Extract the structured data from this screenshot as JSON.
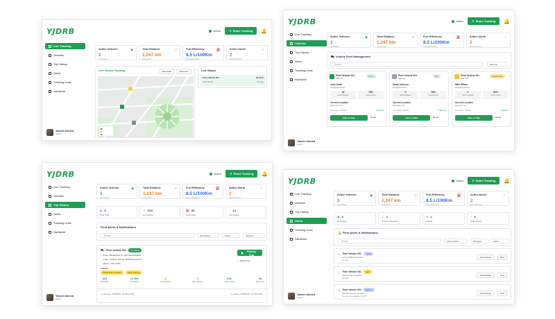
{
  "brand": {
    "logo_text": "YJDRB",
    "accent": "#1f9d55"
  },
  "topbar": {
    "status": "Active",
    "share_button": "Share Tracking"
  },
  "sidebar": {
    "items": [
      {
        "label": "Live Tracking"
      },
      {
        "label": "Vehicles"
      },
      {
        "label": "Trip History"
      },
      {
        "label": "Alerts"
      },
      {
        "label": "Tracking Links"
      },
      {
        "label": "Hardware"
      }
    ]
  },
  "user": {
    "name": "Yasser Ahmed",
    "role": "Admin"
  },
  "kpis": {
    "active_vehicles": {
      "label": "Active Vehicles",
      "value": "1",
      "sub": "All vehicles"
    },
    "total_distance": {
      "label": "Total Distance",
      "value": "1,247 km",
      "sub": "This period"
    },
    "fuel_efficiency": {
      "label": "Fuel Efficiency",
      "value": "8.5 L/100Km",
      "sub": "Avg consumption"
    },
    "active_alerts": {
      "label": "Active Alerts",
      "value": "2",
      "sub": "Need attention"
    }
  },
  "p1": {
    "map_title": "Live Vehicle Tracking",
    "map_btn_1": "MapTrack",
    "map_btn_2": "Fullscreen",
    "live_status_title": "Live Status",
    "status_row_vehicle": "Fleet Vehicle 001",
    "status_row_driver": "John Smith",
    "status_row_speed": "32 km/h",
    "status_row_state": "Moving"
  },
  "p2": {
    "section_title": "Vehicle Fleet Management",
    "search_placeholder": "Search",
    "filter_label": "Filter All",
    "vehicles": [
      {
        "name": "Fleet Vehicle 001",
        "plate": "ABC 1a",
        "badge": "Active",
        "driver": "John Smith",
        "driver_role": "Assigned Driver",
        "speed": "16",
        "speed_label": "km/h speed",
        "fuel": "78%",
        "fuel_label": "Fuel Level",
        "loc_label": "Current Location",
        "loc": "New York, NY",
        "updated": "Last update: 7/8/2025",
        "signal": "Signal OK",
        "map_btn": "View on Map",
        "route_btn": "Route"
      },
      {
        "name": "Fleet Vehicle 001",
        "plate": "ABC 1a",
        "badge": "Idle",
        "driver": "Sarah Johnson",
        "driver_role": "Assigned Driver",
        "speed": "0",
        "speed_label": "km/h speed",
        "fuel": "78%",
        "fuel_label": "Fuel Level",
        "loc_label": "Current Location",
        "loc": "Brooklyn, NY",
        "updated": "Last update: 7/8/2025",
        "signal": "Signal OK",
        "map_btn": "View on Map",
        "route_btn": "Route"
      },
      {
        "name": "Fleet Vehicle 001",
        "plate": "ABC 1a",
        "badge": "Maintenance",
        "driver": "Mike Wilson",
        "driver_role": "Assigned Driver",
        "speed": "0",
        "speed_label": "km/h speed",
        "fuel": "62%",
        "fuel_label": "Fuel Level",
        "loc_label": "Current Location",
        "loc": "Queens, NY",
        "updated": "Last update: 7/8/2025",
        "signal": "Signal OK",
        "map_btn": "View on Map",
        "route_btn": "Route"
      }
    ]
  },
  "p3": {
    "mini_stats": [
      {
        "value": "3",
        "label": "Total Trips"
      },
      {
        "value": "19.5",
        "label": "km Tracked"
      },
      {
        "value": "93",
        "label": "Fuel Used"
      },
      {
        "value": "14",
        "label": "Avg Speed"
      }
    ],
    "section_title": "Fleet Alerts & Notifications",
    "search_placeholder": "Search",
    "filter_1": "All Vehicles",
    "filter_2": "Today",
    "export_label": "Export",
    "trip": {
      "vehicle": "Fleet Vehicle 001",
      "badge": "Completed",
      "from": "From: Whitehouse Jr, 123 Industrial Blvd",
      "to": "From: Coltmen Ster St, 456 Business Ave",
      "driver": "Driver: John Smith",
      "alerts_label": "2 Alerts",
      "tag_1": "Speed limit exceeded",
      "tag_2": "Harsh Braking",
      "metrics": [
        {
          "value": "43.5",
          "label": "Distance"
        },
        {
          "value": "1h 45m",
          "label": "Duration"
        },
        {
          "value": "42",
          "label": "Avg Speed"
        },
        {
          "value": "71",
          "label": "Max Speed"
        },
        {
          "value": "5.5L",
          "label": "Fuel Used"
        },
        {
          "value": "7m",
          "label": "Idle Time"
        }
      ],
      "replay_btn": "Replay Trip",
      "export_btn": "Route Plan",
      "started": "Started: 7/28/2025, 10:00:24 PM",
      "ended": "Ended: 7/28/2025, 11:45:31 PM"
    }
  },
  "p4": {
    "mini_stats": [
      {
        "value": "3",
        "label": "Total Alert"
      },
      {
        "value": "2",
        "label": "Unacknowledged"
      },
      {
        "value": "1",
        "label": "Critical"
      },
      {
        "value": "0",
        "label": "High Priority"
      }
    ],
    "section_title": "Fleet Alerts & Notifications",
    "search_placeholder": "Search",
    "filter_1": "All Severities",
    "filter_2": "All Types",
    "filter_3": "Active",
    "alerts": [
      {
        "vehicle": "Fleet Vehicle 002",
        "badge": "Critical",
        "desc": "Low fuel/fleet detected",
        "meta": "Storage",
        "ack": "Acknowledge",
        "view": "View"
      },
      {
        "vehicle": "Fleet Vehicle 001",
        "badge": "High",
        "desc": "Speed limit exceeded",
        "meta": "Storage",
        "ack": "Acknowledge",
        "view": "View"
      },
      {
        "vehicle": "Fleet Vehicle 001",
        "badge": "Medium",
        "desc": "Vehicle has left geofence",
        "meta": "Storage  Acknowledge 1:22 PM",
        "ack": "Acknowledge",
        "view": "View"
      }
    ]
  }
}
